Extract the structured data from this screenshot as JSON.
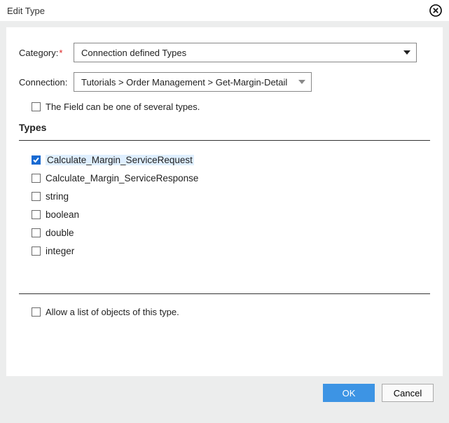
{
  "dialog": {
    "title": "Edit Type"
  },
  "form": {
    "category_label": "Category:",
    "category_value": "Connection defined Types",
    "connection_label": "Connection:",
    "connection_value": "Tutorials > Order Management > Get-Margin-Detail",
    "multi_type_label": "The Field can be one of several types.",
    "multi_type_checked": false
  },
  "types": {
    "heading": "Types",
    "items": [
      {
        "label": "Calculate_Margin_ServiceRequest",
        "checked": true,
        "selected": true
      },
      {
        "label": "Calculate_Margin_ServiceResponse",
        "checked": false,
        "selected": false
      },
      {
        "label": "string",
        "checked": false,
        "selected": false
      },
      {
        "label": "boolean",
        "checked": false,
        "selected": false
      },
      {
        "label": "double",
        "checked": false,
        "selected": false
      },
      {
        "label": "integer",
        "checked": false,
        "selected": false
      }
    ]
  },
  "allow_list": {
    "label": "Allow a list of objects of this type.",
    "checked": false
  },
  "buttons": {
    "ok": "OK",
    "cancel": "Cancel"
  }
}
